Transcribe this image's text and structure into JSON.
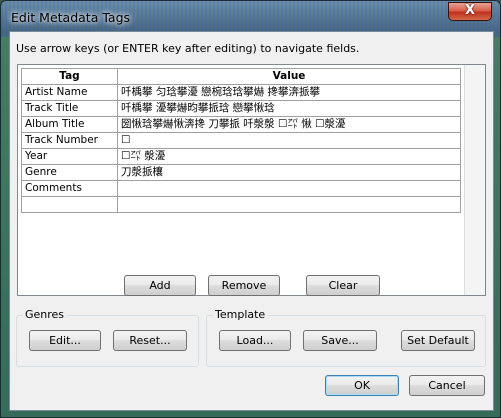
{
  "window": {
    "title": "Edit Metadata Tags",
    "close_label": "X"
  },
  "instructions": "Use arrow keys (or ENTER key after editing) to navigate fields.",
  "grid": {
    "headers": {
      "tag": "Tag",
      "value": "Value"
    },
    "rows": [
      {
        "tag": "Artist Name",
        "value": "吀楀攀 匀琀攀瀀 戀椀琀琀攀爀 搀攀渀挀攀"
      },
      {
        "tag": "Track Title",
        "value": "吀楀攀 瀀攀爀昀攀挀琀 戀攀愀琀"
      },
      {
        "tag": "Album Title",
        "value": "圀愀琀攀爀愀渀搀 刀攀挀 吀漀漀 ☐㌀ 愀 ☐漀瀀"
      },
      {
        "tag": "Track Number",
        "value": "☐"
      },
      {
        "tag": "Year",
        "value": "☐㌀ 漀瀀"
      },
      {
        "tag": "Genre",
        "value": "刀漀挀欀"
      },
      {
        "tag": "Comments",
        "value": ""
      },
      {
        "tag": "",
        "value": ""
      }
    ]
  },
  "buttons": {
    "add": "Add",
    "remove": "Remove",
    "clear": "Clear",
    "edit": "Edit...",
    "reset": "Reset...",
    "load": "Load...",
    "save": "Save...",
    "set_default": "Set Default",
    "ok": "OK",
    "cancel": "Cancel"
  },
  "groups": {
    "genres": "Genres",
    "template": "Template"
  },
  "colors": {
    "client_background": "#f0f0f0",
    "close_button": "#c0301c",
    "default_button_border": "#3c7fb1"
  }
}
